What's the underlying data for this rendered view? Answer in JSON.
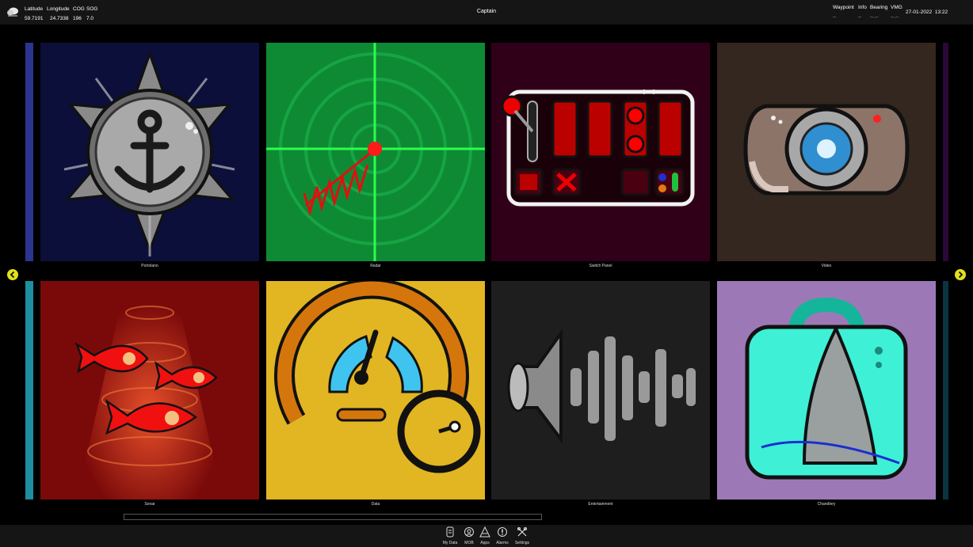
{
  "topbar": {
    "latitude_label": "Latitude",
    "latitude_value": "59.7191",
    "longitude_label": "Longitude",
    "longitude_value": "24.7338",
    "cog_label": "COG",
    "cog_value": "196",
    "sog_label": "SOG",
    "sog_value": "7.0",
    "title": "Captain",
    "waypoint_label": "Waypoint",
    "waypoint_value": "--",
    "info_label": "Info",
    "info_value": "--",
    "bearing_label": "Bearing",
    "bearing_value": "--.--",
    "vmg_label": "VMG",
    "vmg_value": "--.--",
    "date": "27-01-2022",
    "time": "13:22"
  },
  "apps": [
    {
      "label": "Portolano",
      "icon": "anchor-badge-icon",
      "color": "#0b0f3a"
    },
    {
      "label": "Radar",
      "icon": "radar-icon",
      "color": "#0e8a35"
    },
    {
      "label": "Switch Panel",
      "icon": "switch-panel-icon",
      "color": "#300018"
    },
    {
      "label": "Video",
      "icon": "camera-icon",
      "color": "#33271f"
    },
    {
      "label": "Sonar",
      "icon": "fish-sonar-icon",
      "color": "#7a0a0a"
    },
    {
      "label": "Data",
      "icon": "gauge-icon",
      "color": "#e2b522"
    },
    {
      "label": "Entertainment",
      "icon": "speaker-icon",
      "color": "#1e1e1e"
    },
    {
      "label": "Chandlery",
      "icon": "shopping-bag-icon",
      "color": "#9c79b6"
    }
  ],
  "dock": [
    {
      "label": "My Data",
      "icon": "data-icon"
    },
    {
      "label": "MOB",
      "icon": "mob-icon"
    },
    {
      "label": "Apps",
      "icon": "apps-icon"
    },
    {
      "label": "Alarms",
      "icon": "alarm-icon"
    },
    {
      "label": "Settings",
      "icon": "settings-icon"
    }
  ],
  "colors": {
    "arrow": "#e4e01c",
    "edge_top_left": "#2b3590",
    "edge_bottom_left": "#1e8fa0",
    "edge_top_right": "#2a0838",
    "edge_bottom_right": "#0a3440"
  }
}
